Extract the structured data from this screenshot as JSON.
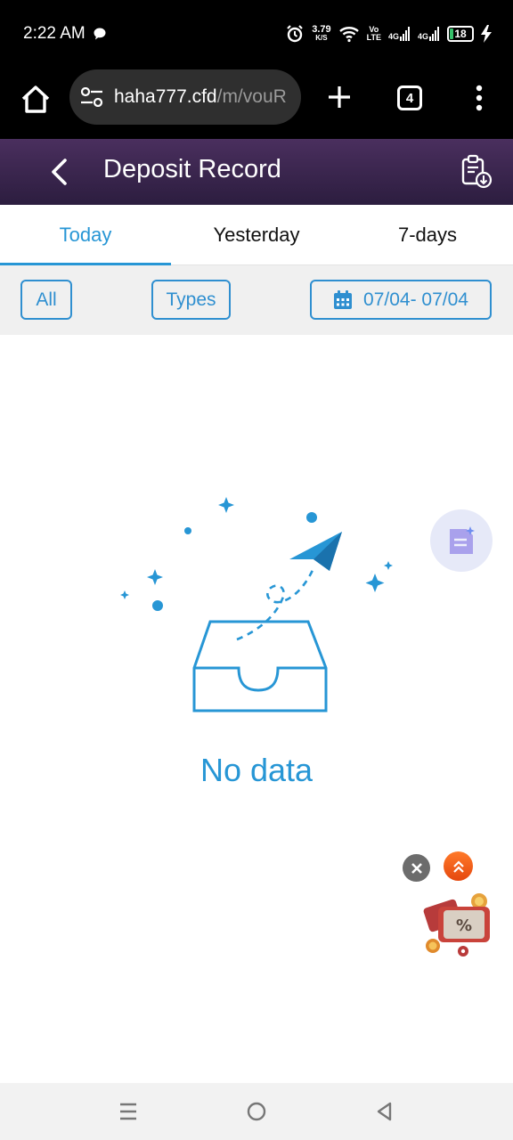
{
  "status_bar": {
    "time": "2:22 AM",
    "net_speed_value": "3.79",
    "net_speed_unit": "K/S",
    "volte_top": "Vo",
    "volte_bottom": "LTE",
    "sim1": "4G",
    "sim2": "4G",
    "battery": "18",
    "icons": [
      "chat-bubble-icon",
      "alarm-icon",
      "wifi-icon",
      "signal-icon",
      "charging-icon"
    ],
    "battery_color": "#35c06a"
  },
  "browser": {
    "url_host": "haha777.cfd",
    "url_path": "/m/vouR",
    "tab_count": "4",
    "icons": [
      "home-icon",
      "tune-icon",
      "plus-icon",
      "more-vert-icon"
    ]
  },
  "header": {
    "title": "Deposit Record",
    "icons": [
      "back-icon",
      "clipboard-download-icon"
    ]
  },
  "tabs": [
    {
      "label": "Today",
      "active": true
    },
    {
      "label": "Yesterday",
      "active": false
    },
    {
      "label": "7-days",
      "active": false
    }
  ],
  "filters": {
    "all_label": "All",
    "types_label": "Types",
    "date_range": "07/04- 07/04",
    "icons": [
      "calendar-icon"
    ]
  },
  "empty_state": {
    "message": "No data"
  },
  "floating": {
    "icons": [
      "document-sparkle-icon",
      "close-icon",
      "double-chevron-up-icon",
      "promo-coupon-icon"
    ]
  },
  "colors": {
    "accent": "#2796d5",
    "header_top": "#4a2f5e",
    "header_bottom": "#2c1d3f",
    "filter_bg": "#f0f0f0"
  }
}
